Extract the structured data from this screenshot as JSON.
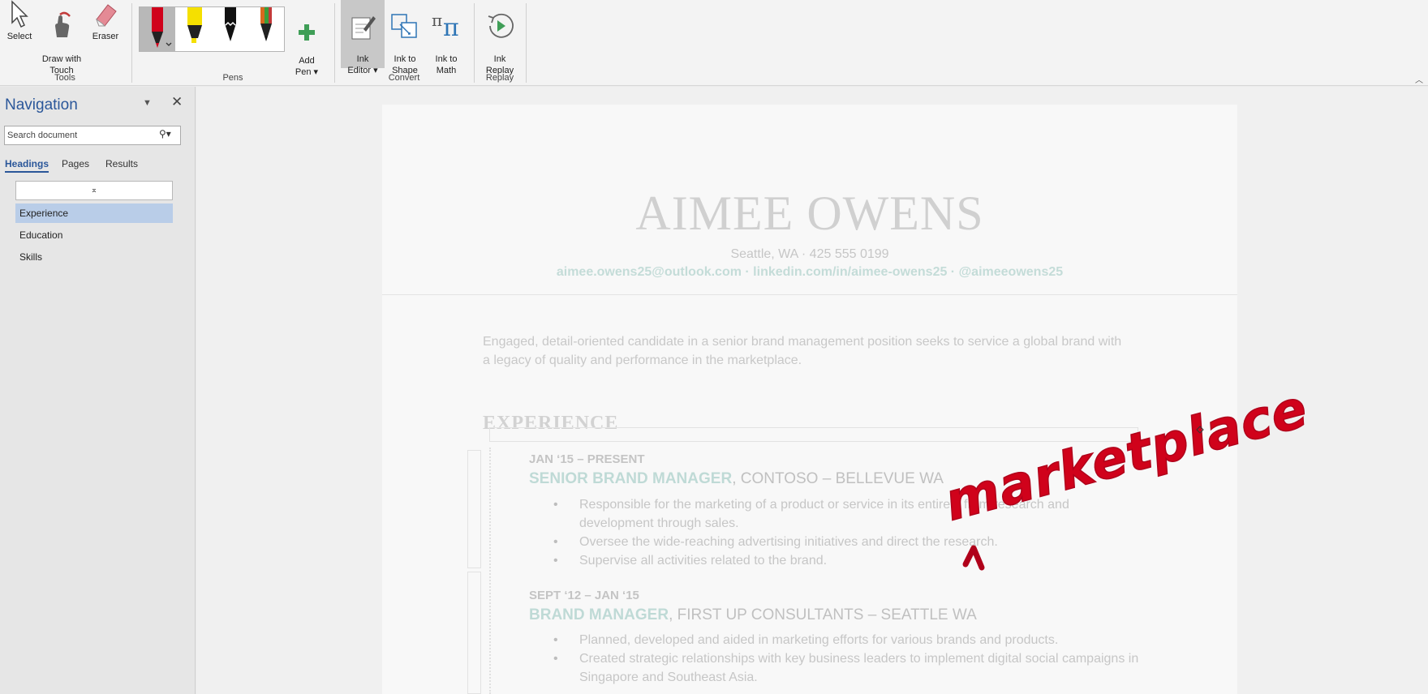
{
  "ribbon": {
    "tools": {
      "group_label": "Tools",
      "select_label": "Select",
      "draw_touch_label": "Draw with\nTouch",
      "eraser_label": "Eraser"
    },
    "pens": {
      "group_label": "Pens",
      "add_pen_label": "Add\nPen ▾",
      "pen_colors": [
        "#d0021b",
        "#f5e000",
        "#111111",
        "#2a2a2a"
      ]
    },
    "convert": {
      "group_label": "Convert",
      "ink_editor_label": "Ink\nEditor ▾",
      "ink_to_shape_label": "Ink to\nShape",
      "ink_to_math_label": "Ink to\nMath"
    },
    "replay": {
      "group_label": "Replay",
      "ink_replay_label": "Ink\nReplay"
    }
  },
  "navigation": {
    "title": "Navigation",
    "search_placeholder": "Search document",
    "tabs": [
      "Headings",
      "Pages",
      "Results"
    ],
    "active_tab": "Headings",
    "headings": [
      "Experience",
      "Education",
      "Skills"
    ],
    "selected_heading": "Experience"
  },
  "document": {
    "name": "AIMEE OWENS",
    "contact": "Seattle, WA · 425 555 0199",
    "links": "aimee.owens25@outlook.com · linkedin.com/in/aimee-owens25 · @aimeeowens25",
    "objective": "Engaged, detail-oriented candidate in a senior brand management position seeks to service a global brand with a legacy of quality and performance in the marketplace.",
    "section_heading": "EXPERIENCE",
    "jobs": [
      {
        "dates": "JAN ‘15 – PRESENT",
        "role": "SENIOR BRAND MANAGER",
        "company": ", CONTOSO – BELLEVUE WA",
        "bullets": [
          "Responsible for the marketing of a product or service in its entirety from research and development through sales.",
          "Oversee the wide-reaching advertising initiatives and direct the research.",
          "Supervise all activities related to the brand."
        ]
      },
      {
        "dates": "SEPT ‘12 – JAN ‘15",
        "role": "BRAND MANAGER",
        "company": ", FIRST UP CONSULTANTS – SEATTLE WA",
        "bullets": [
          "Planned, developed and aided in marketing efforts for various brands and products.",
          "Created strategic relationships with key business leaders to implement digital social campaigns in Singapore and Southeast Asia."
        ]
      }
    ]
  },
  "ink_annotation": {
    "text": "marketplace",
    "color": "#d0021b"
  }
}
